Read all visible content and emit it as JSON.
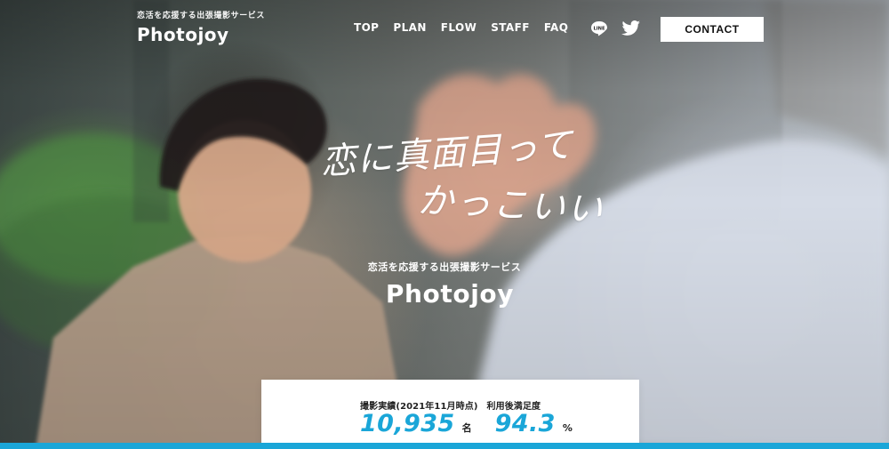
{
  "header": {
    "brand_tagline": "恋活を応援する出張撮影サービス",
    "brand_name": "Photojoy",
    "nav": [
      "TOP",
      "PLAN",
      "FLOW",
      "STAFF",
      "FAQ"
    ],
    "social": [
      {
        "name": "LINE",
        "icon": "line-icon"
      },
      {
        "name": "Twitter",
        "icon": "twitter-icon"
      }
    ],
    "contact_label": "CONTACT"
  },
  "hero": {
    "script_line1": "恋に真面目って",
    "script_line2": "かっこいい",
    "tagline": "恋活を応援する出張撮影サービス",
    "name": "Photojoy"
  },
  "stats": {
    "label_left": "撮影実績(2021年11月時点)",
    "label_right": "利用後満足度",
    "values": [
      {
        "value": "10,935",
        "unit": "名"
      },
      {
        "value": "94.3",
        "unit": "%"
      }
    ]
  },
  "colors": {
    "accent": "#1aa6d8"
  }
}
